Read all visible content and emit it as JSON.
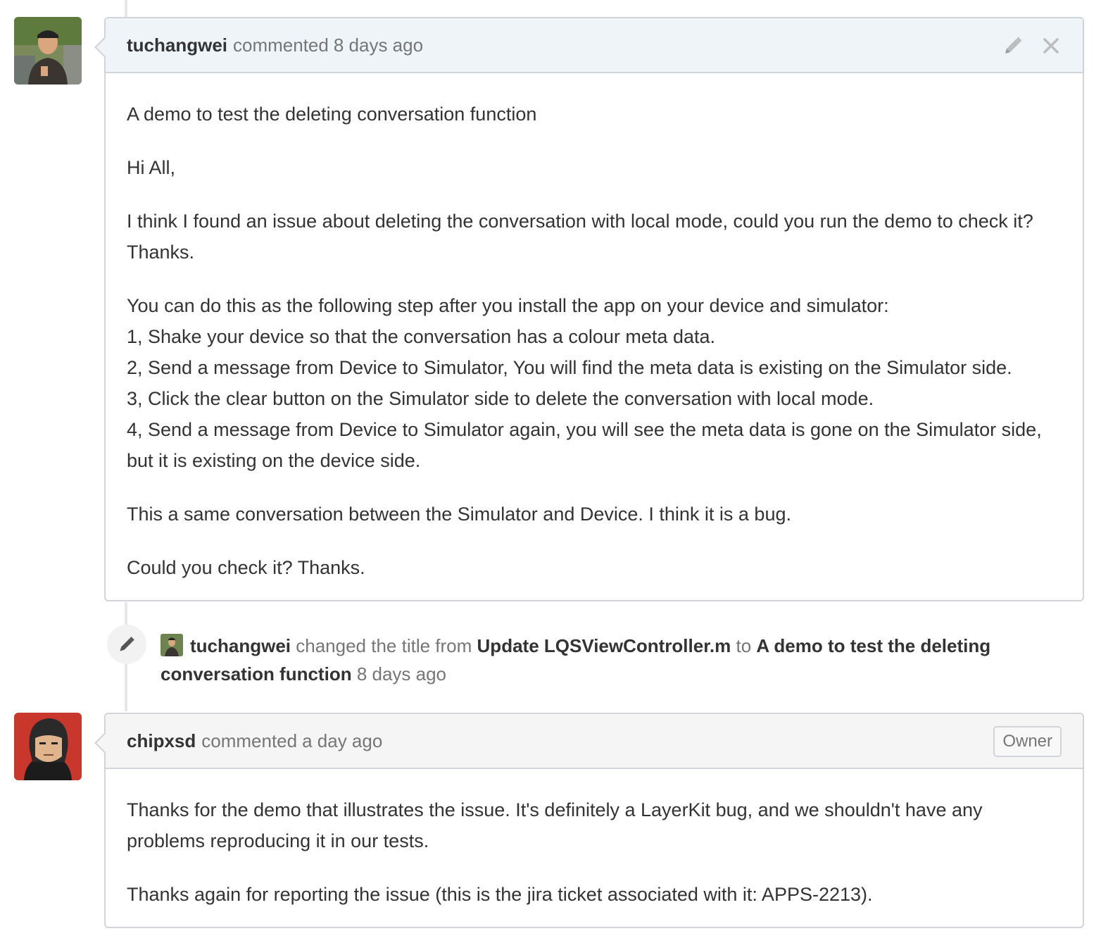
{
  "comment1": {
    "author": "tuchangwei",
    "action": "commented",
    "time": "8 days ago",
    "paragraphs": [
      "A demo to test the deleting conversation function",
      "Hi All,",
      "I think I found an issue about deleting the conversation with local mode, could you run the demo to check it? Thanks."
    ],
    "steps_intro": "You can do this as the following step after you install the app on your device and simulator:",
    "steps": [
      "1, Shake your device so that the conversation has a colour meta data.",
      "2, Send a message from Device to Simulator, You will find the meta data is existing on the Simulator side.",
      "3, Click the clear button on the Simulator side to delete the conversation with local mode.",
      "4, Send a message from Device to Simulator again, you will see the meta data is gone on the Simulator side, but it is existing on the device side."
    ],
    "closing": [
      "This a same conversation between the Simulator and Device. I think it is a bug.",
      "Could you check it? Thanks."
    ],
    "icons": {
      "edit": "pencil-icon",
      "delete": "close-icon"
    }
  },
  "title_event": {
    "actor": "tuchangwei",
    "text_changed": "changed the title from",
    "old_title": "Update LQSViewController.m",
    "text_to": "to",
    "new_title": "A demo to test the deleting conversation function",
    "time": "8 days ago",
    "icon": "pencil-icon"
  },
  "comment2": {
    "author": "chipxsd",
    "action": "commented",
    "time": "a day ago",
    "badge": "Owner",
    "paragraphs": [
      "Thanks for the demo that illustrates the issue. It's definitely a LayerKit bug, and we shouldn't have any problems reproducing it in our tests.",
      "Thanks again for reporting the issue (this is the jira ticket associated with it: APPS-2213)."
    ]
  },
  "colors": {
    "header_blue": "#eef4f8",
    "header_gray": "#f5f5f5",
    "border": "#d1d5da",
    "muted_text": "#767676",
    "text": "#333333"
  }
}
